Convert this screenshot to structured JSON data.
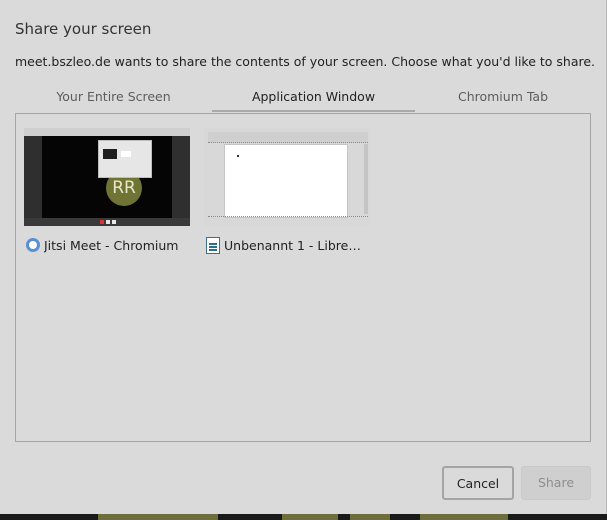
{
  "dialog": {
    "title": "Share your screen",
    "description": "meet.bszleo.de wants to share the contents of your screen. Choose what you'd like to share."
  },
  "tabs": [
    {
      "label": "Your Entire Screen",
      "active": false
    },
    {
      "label": "Application Window",
      "active": true
    },
    {
      "label": "Chromium Tab",
      "active": false
    }
  ],
  "sources": [
    {
      "name": "Jitsi Meet - Chromium",
      "icon": "chromium-icon",
      "thumbnail_avatar_text": "RR"
    },
    {
      "name": "Unbenannt 1 - LibreOffice Writer",
      "display_name": "Unbenannt 1 - LibreOff...",
      "icon": "libreoffice-writer-icon"
    }
  ],
  "buttons": {
    "cancel_label": "Cancel",
    "share_label": "Share",
    "share_enabled": false
  },
  "colors": {
    "dialog_background": "#dadada",
    "avatar": "#6f7435",
    "border": "#a5a5a5"
  }
}
